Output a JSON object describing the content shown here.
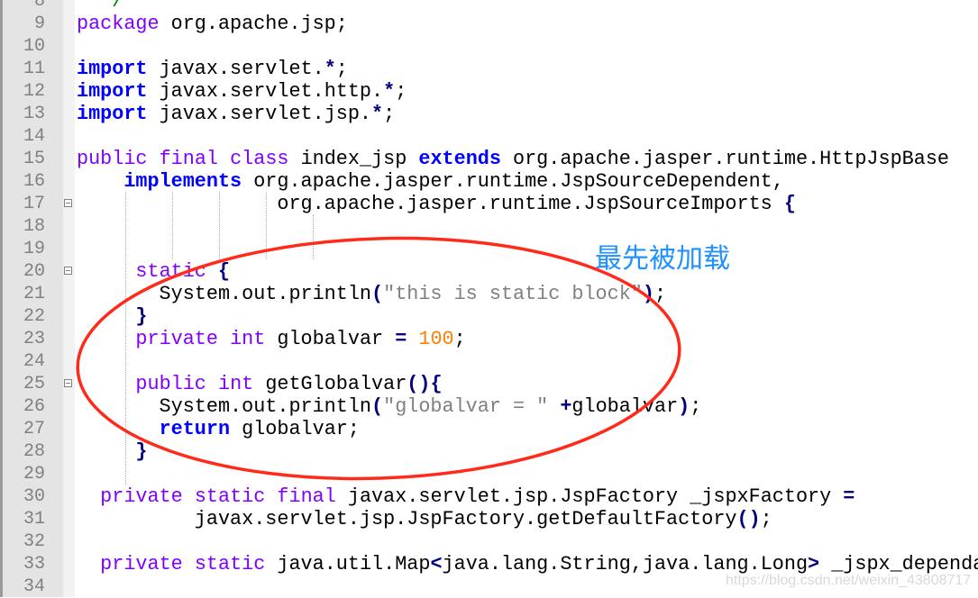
{
  "editor": {
    "first_line": 8,
    "lines": [
      [
        [
          "cm",
          "  */"
        ]
      ],
      [
        [
          "kw",
          "package"
        ],
        [
          "t",
          " org.apache.jsp;"
        ]
      ],
      [],
      [
        [
          "kb",
          "import"
        ],
        [
          "t",
          " javax.servlet."
        ],
        [
          "op",
          "*"
        ],
        [
          "t",
          ";"
        ]
      ],
      [
        [
          "kb",
          "import"
        ],
        [
          "t",
          " javax.servlet.http."
        ],
        [
          "op",
          "*"
        ],
        [
          "t",
          ";"
        ]
      ],
      [
        [
          "kb",
          "import"
        ],
        [
          "t",
          " javax.servlet.jsp."
        ],
        [
          "op",
          "*"
        ],
        [
          "t",
          ";"
        ]
      ],
      [],
      [
        [
          "kw",
          "public"
        ],
        [
          "t",
          " "
        ],
        [
          "kw",
          "final"
        ],
        [
          "t",
          " "
        ],
        [
          "kw",
          "class"
        ],
        [
          "t",
          " index_jsp "
        ],
        [
          "kb",
          "extends"
        ],
        [
          "t",
          " org.apache.jasper.runtime.HttpJspBase"
        ]
      ],
      [
        [
          "t",
          "    "
        ],
        [
          "kb",
          "implements"
        ],
        [
          "t",
          " org.apache.jasper.runtime.JspSourceDependent,"
        ]
      ],
      [
        [
          "t",
          "                 org.apache.jasper.runtime.JspSourceImports "
        ],
        [
          "op",
          "{"
        ]
      ],
      [],
      [],
      [
        [
          "t",
          "     "
        ],
        [
          "kw",
          "static"
        ],
        [
          "t",
          " "
        ],
        [
          "op",
          "{"
        ]
      ],
      [
        [
          "t",
          "       System.out.println"
        ],
        [
          "op",
          "("
        ],
        [
          "str",
          "\"this is static block\""
        ],
        [
          "op",
          ")"
        ],
        [
          "t",
          ";"
        ]
      ],
      [
        [
          "t",
          "     "
        ],
        [
          "op",
          "}"
        ]
      ],
      [
        [
          "t",
          "     "
        ],
        [
          "kw",
          "private"
        ],
        [
          "t",
          " "
        ],
        [
          "kw",
          "int"
        ],
        [
          "t",
          " globalvar "
        ],
        [
          "op",
          "="
        ],
        [
          "t",
          " "
        ],
        [
          "num",
          "100"
        ],
        [
          "t",
          ";"
        ]
      ],
      [],
      [
        [
          "t",
          "     "
        ],
        [
          "kw",
          "public"
        ],
        [
          "t",
          " "
        ],
        [
          "kw",
          "int"
        ],
        [
          "t",
          " getGlobalvar"
        ],
        [
          "op",
          "(){"
        ]
      ],
      [
        [
          "t",
          "       System.out.println"
        ],
        [
          "op",
          "("
        ],
        [
          "str",
          "\"globalvar = \""
        ],
        [
          "t",
          " "
        ],
        [
          "op",
          "+"
        ],
        [
          "t",
          "globalvar"
        ],
        [
          "op",
          ")"
        ],
        [
          "t",
          ";"
        ]
      ],
      [
        [
          "t",
          "       "
        ],
        [
          "kb",
          "return"
        ],
        [
          "t",
          " globalvar;"
        ]
      ],
      [
        [
          "t",
          "     "
        ],
        [
          "op",
          "}"
        ]
      ],
      [],
      [
        [
          "t",
          "  "
        ],
        [
          "kw",
          "private"
        ],
        [
          "t",
          " "
        ],
        [
          "kw",
          "static"
        ],
        [
          "t",
          " "
        ],
        [
          "kw",
          "final"
        ],
        [
          "t",
          " javax.servlet.jsp.JspFactory _jspxFactory "
        ],
        [
          "op",
          "="
        ]
      ],
      [
        [
          "t",
          "          javax.servlet.jsp.JspFactory.getDefaultFactory"
        ],
        [
          "op",
          "()"
        ],
        [
          "t",
          ";"
        ]
      ],
      [],
      [
        [
          "t",
          "  "
        ],
        [
          "kw",
          "private"
        ],
        [
          "t",
          " "
        ],
        [
          "kw",
          "static"
        ],
        [
          "t",
          " java.util.Map"
        ],
        [
          "op",
          "<"
        ],
        [
          "t",
          "java.lang.String,java.lang.Long"
        ],
        [
          "op",
          ">"
        ],
        [
          "t",
          " _jspx_dependa"
        ]
      ],
      []
    ],
    "fold_lines": [
      17,
      20,
      25
    ]
  },
  "annotation": {
    "text": "最先被加载",
    "color": "#1e90ff",
    "ellipse_color": "#ff2a1a"
  },
  "watermark": "https://blog.csdn.net/weixin_43808717"
}
